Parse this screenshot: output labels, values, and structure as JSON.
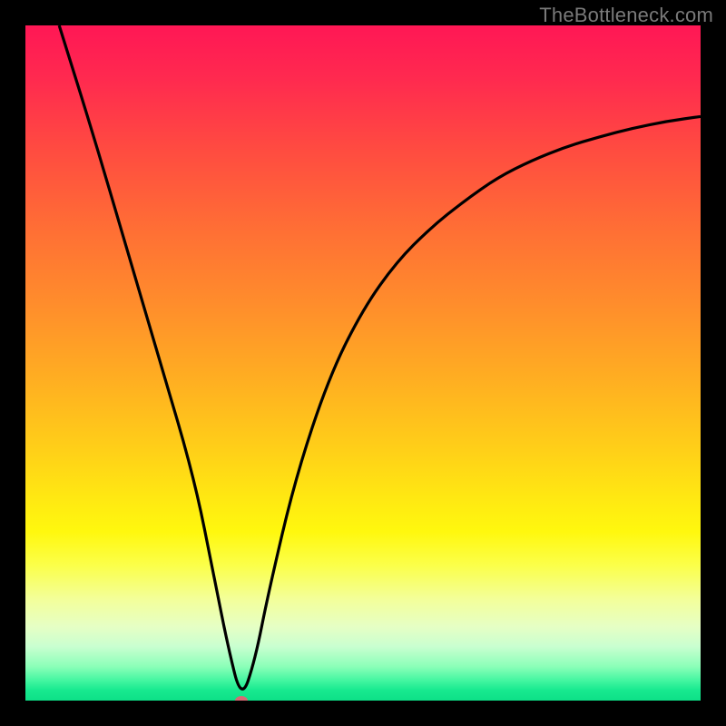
{
  "watermark": "TheBottleneck.com",
  "chart_data": {
    "type": "line",
    "title": "",
    "xlabel": "",
    "ylabel": "",
    "xlim": [
      0,
      100
    ],
    "ylim": [
      0,
      100
    ],
    "grid": false,
    "legend": false,
    "series": [
      {
        "name": "bottleneck-curve",
        "x": [
          5,
          10,
          15,
          20,
          25,
          28,
          30,
          32,
          34,
          36,
          40,
          45,
          50,
          55,
          60,
          65,
          70,
          75,
          80,
          85,
          90,
          95,
          100
        ],
        "y": [
          100,
          84,
          67,
          50,
          33,
          18,
          8,
          0,
          6,
          16,
          33,
          48,
          58,
          65,
          70,
          74,
          77.5,
          80,
          82,
          83.5,
          84.8,
          85.8,
          86.5
        ]
      }
    ],
    "annotations": [
      {
        "name": "optimum-point",
        "x": 32,
        "y": 0
      }
    ]
  },
  "colors": {
    "curve": "#000000",
    "marker": "#d66a75",
    "background_frame": "#000000"
  }
}
